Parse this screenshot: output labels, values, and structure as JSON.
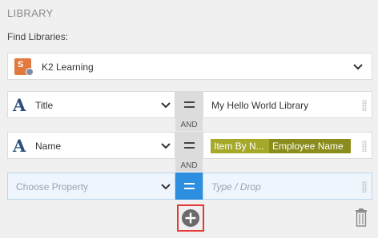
{
  "section_title": "LIBRARY",
  "find_label": "Find Libraries:",
  "library": {
    "name": "K2 Learning",
    "icon": "library-icon"
  },
  "conditions": [
    {
      "property": "Title",
      "operator": "=",
      "value": "My Hello World Library"
    },
    {
      "property": "Name",
      "operator": "=",
      "value_chips": [
        "Item By N...",
        "Employee Name"
      ]
    },
    {
      "property": "Choose Property",
      "operator": "=",
      "value_placeholder": "Type / Drop"
    }
  ],
  "joiners": [
    "AND",
    "AND"
  ],
  "icons": {
    "add": "plus-circle-icon",
    "delete": "trash-icon",
    "dropdown": "chevron-down-icon",
    "text_type": "text-type-icon",
    "grip": "drag-handle-icon"
  },
  "colors": {
    "operator_active": "#2d8ee0",
    "chip_primary": "#a5a828",
    "chip_secondary": "#8a8c1b",
    "add_highlight": "#e53935"
  }
}
